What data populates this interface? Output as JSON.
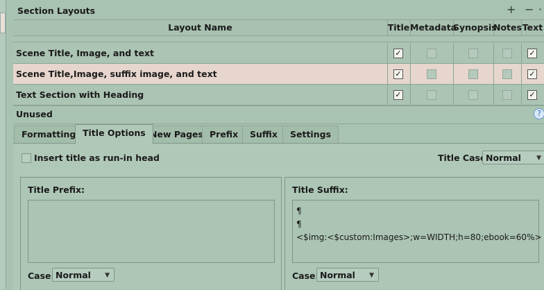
{
  "section": {
    "title": "Section Layouts",
    "add_icon": "+",
    "remove_icon": "−",
    "more_icon": "·"
  },
  "table": {
    "columns": [
      "Layout Name",
      "Title",
      "Metadata",
      "Synopsis",
      "Notes",
      "Text"
    ],
    "rows": [
      {
        "name": "Scene Title, Image, and text",
        "title": true,
        "metadata": false,
        "synopsis": false,
        "notes": false,
        "text": true
      },
      {
        "name": "Scene Title,Image, suffix image, and text",
        "title": true,
        "metadata": false,
        "synopsis": false,
        "notes": false,
        "text": true
      },
      {
        "name": "Text Section with Heading",
        "title": true,
        "metadata": false,
        "synopsis": false,
        "notes": false,
        "text": true
      }
    ],
    "selected_row": 1
  },
  "unused_label": "Unused",
  "help_icon": "?",
  "tabs": [
    "Formatting",
    "Title Options",
    "New Pages",
    "Prefix",
    "Suffix",
    "Settings"
  ],
  "active_tab": "Title Options",
  "options": {
    "runin_label": "Insert title as run-in head",
    "runin_checked": false,
    "title_case_label": "Title Case:",
    "title_case_value": "Normal"
  },
  "prefix": {
    "title": "Title Prefix:",
    "value": "",
    "case_label": "Case:",
    "case_value": "Normal"
  },
  "suffix": {
    "title": "Title Suffix:",
    "lines": [
      "¶",
      "¶",
      "<$img:<$custom:Images>;w=WIDTH;h=80;ebook=60%>"
    ],
    "case_label": "Case:",
    "case_value": "Normal"
  },
  "colors": {
    "background": "#a9c3b2",
    "selected_row": "#e6d6cd"
  }
}
